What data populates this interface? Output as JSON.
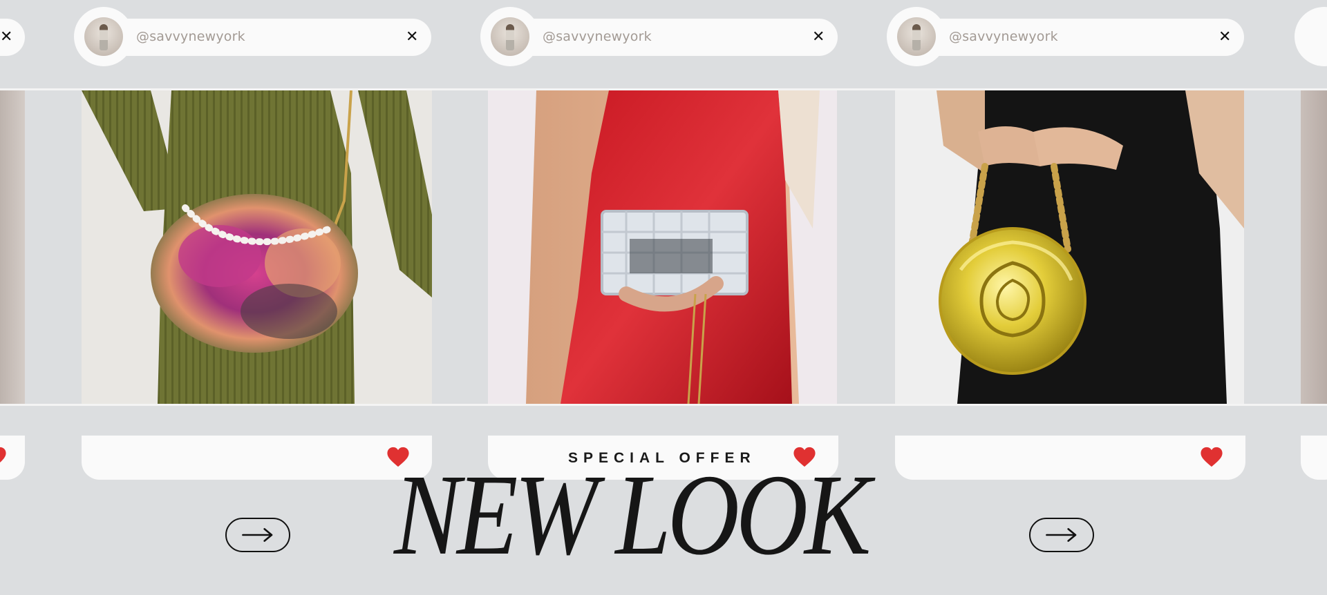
{
  "cards": [
    {
      "handle": "@savvynewyork",
      "close": "✕"
    },
    {
      "handle": "@savvynewyork",
      "close": "✕"
    },
    {
      "handle": "@savvynewyork",
      "close": "✕"
    }
  ],
  "edge_close": "✕",
  "banner": {
    "special_offer": "SPECIAL OFFER",
    "headline": "NEW LOOK"
  },
  "colors": {
    "background": "#dcdee0",
    "heart": "#e03131",
    "text": "#161616"
  },
  "icons": [
    "heart-icon",
    "close-icon",
    "arrow-right-icon"
  ]
}
